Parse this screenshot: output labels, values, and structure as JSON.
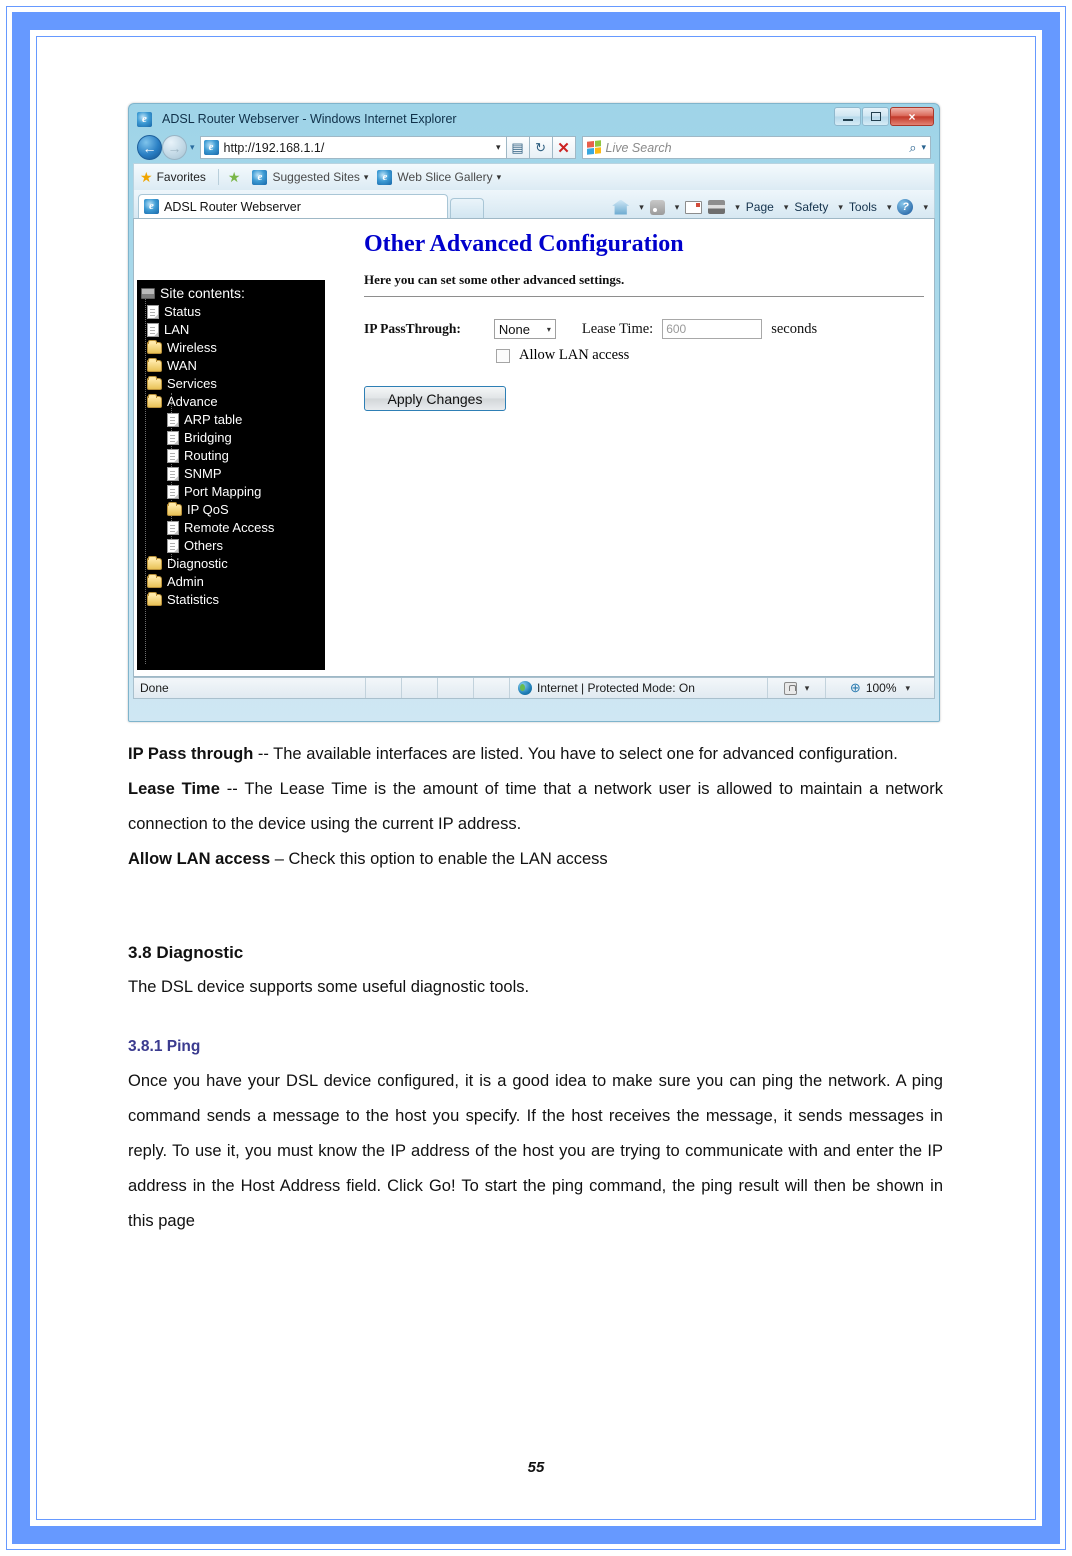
{
  "frame": {
    "accent_color": "#6699ff"
  },
  "browser": {
    "title": "ADSL Router Webserver - Windows Internet Explorer",
    "window_buttons": {
      "minimize": "minimize-button",
      "maximize": "maximize-button",
      "close": "×"
    },
    "address": {
      "url": "http://192.168.1.1/",
      "dropdown_caret": "▾",
      "tools": {
        "compat": "⬚",
        "refresh": "↻",
        "stop": "✕"
      }
    },
    "search": {
      "placeholder": "Live Search",
      "magnifier": "⌕",
      "caret": "▾"
    },
    "favorites_bar": {
      "favorites_label": "Favorites",
      "suggested_sites": "Suggested Sites",
      "web_slice_gallery": "Web Slice Gallery",
      "caret": "▾"
    },
    "tab": {
      "label": "ADSL Router Webserver"
    },
    "command_bar": {
      "home": "home-icon",
      "feeds": "feeds-icon",
      "mail": "mail-icon",
      "print": "print-icon",
      "page": "Page",
      "safety": "Safety",
      "tools": "Tools",
      "help": "?",
      "caret": "▾"
    },
    "statusbar": {
      "status": "Done",
      "zone": "Internet | Protected Mode: On",
      "zoom": "100%",
      "caret": "▾"
    }
  },
  "router_page": {
    "sidebar": {
      "root": "Site contents:",
      "items": [
        {
          "label": "Status",
          "icon": "page-icon",
          "level": 1
        },
        {
          "label": "LAN",
          "icon": "page-icon",
          "level": 1
        },
        {
          "label": "Wireless",
          "icon": "folder-icon",
          "level": 1
        },
        {
          "label": "WAN",
          "icon": "folder-icon",
          "level": 1
        },
        {
          "label": "Services",
          "icon": "folder-icon",
          "level": 1
        },
        {
          "label": "Advance",
          "icon": "folder-open-icon",
          "level": 1
        },
        {
          "label": "ARP table",
          "icon": "page-icon",
          "level": 2
        },
        {
          "label": "Bridging",
          "icon": "page-icon",
          "level": 2
        },
        {
          "label": "Routing",
          "icon": "page-icon",
          "level": 2
        },
        {
          "label": "SNMP",
          "icon": "page-icon",
          "level": 2
        },
        {
          "label": "Port Mapping",
          "icon": "page-icon",
          "level": 2
        },
        {
          "label": "IP QoS",
          "icon": "folder-icon",
          "level": 2
        },
        {
          "label": "Remote Access",
          "icon": "page-icon",
          "level": 2
        },
        {
          "label": "Others",
          "icon": "page-icon",
          "level": 2
        },
        {
          "label": "Diagnostic",
          "icon": "folder-icon",
          "level": 1
        },
        {
          "label": "Admin",
          "icon": "folder-icon",
          "level": 1
        },
        {
          "label": "Statistics",
          "icon": "folder-icon",
          "level": 1
        }
      ]
    },
    "heading": "Other Advanced Configuration",
    "description": "Here you can set some other advanced settings.",
    "form": {
      "passthrough_label": "IP PassThrough:",
      "passthrough_value": "None",
      "passthrough_caret": "▾",
      "lease_label": "Lease Time:",
      "lease_value": "600",
      "lease_unit": "seconds",
      "allow_lan_label": "Allow LAN access",
      "apply_button": "Apply Changes"
    }
  },
  "document": {
    "p_ip_pass_label": "IP Pass through",
    "p_ip_pass_text": " -- The available interfaces are listed. You have to select one for advanced configuration.",
    "p_lease_label": "Lease Time",
    "p_lease_text": " -- The Lease Time is the amount of time that a network user is allowed to maintain a network connection to the device using the current IP address.",
    "p_allow_label": "Allow LAN access",
    "p_allow_text": " – Check this option to enable the LAN access",
    "h_diagnostic": "3.8 Diagnostic",
    "p_diagnostic": "The DSL device supports some useful diagnostic tools.",
    "h_ping": "3.8.1 Ping",
    "p_ping": "Once you have your DSL device configured, it is a good idea to make sure you can ping the network. A ping command sends a message to the host you specify. If the host receives the message, it sends messages in reply. To use it, you must know the IP address of the host you are trying to communicate with and enter the IP address in the Host Address field. Click Go! To start the ping command, the ping result will then be shown in this page",
    "page_number": "55"
  }
}
